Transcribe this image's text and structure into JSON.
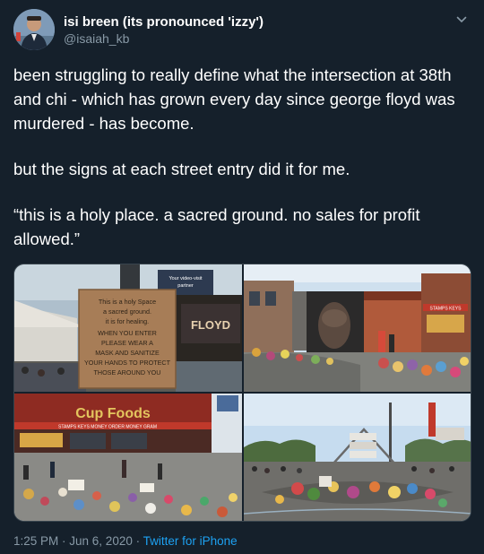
{
  "user": {
    "display_name": "isi breen (its pronounced 'izzy')",
    "handle": "@isaiah_kb"
  },
  "tweet": {
    "paragraph_1": "been struggling to really define what the intersection at 38th and chi - which has grown every day since george floyd was murdered - has become.",
    "paragraph_2": "but the signs at each street entry did it for me.",
    "paragraph_3": "“this is a holy place. a sacred ground. no sales for profit allowed.”"
  },
  "photos": {
    "photo_1": {
      "sign_lines": [
        "This is a holy Space",
        "a sacred ground.",
        "it is for healing.",
        "WHEN YOU ENTER",
        "PLEASE WEAR A",
        "MASK AND SANITIZE",
        "YOUR HANDS TO PROTECT",
        "THOSE AROUND YOU"
      ],
      "billboard_lines": [
        "Your video-visit",
        "partner"
      ],
      "mural_text": "FLOYD"
    },
    "photo_2": {
      "shop_sign": "STAMPS   KEYS"
    },
    "photo_3": {
      "store_sign": "Cup Foods",
      "banner_text": "STAMPS   KEYS   MONEY ORDER   MONEY GRAM"
    }
  },
  "footer": {
    "time": "1:25 PM",
    "separator_1": " · ",
    "date": "Jun 6, 2020",
    "separator_2": " · ",
    "source": "Twitter for iPhone"
  },
  "colors": {
    "background": "#15202b",
    "secondary_text": "#8899a6",
    "link": "#1da1f2"
  },
  "icons": {
    "caret": "chevron-down-icon"
  }
}
